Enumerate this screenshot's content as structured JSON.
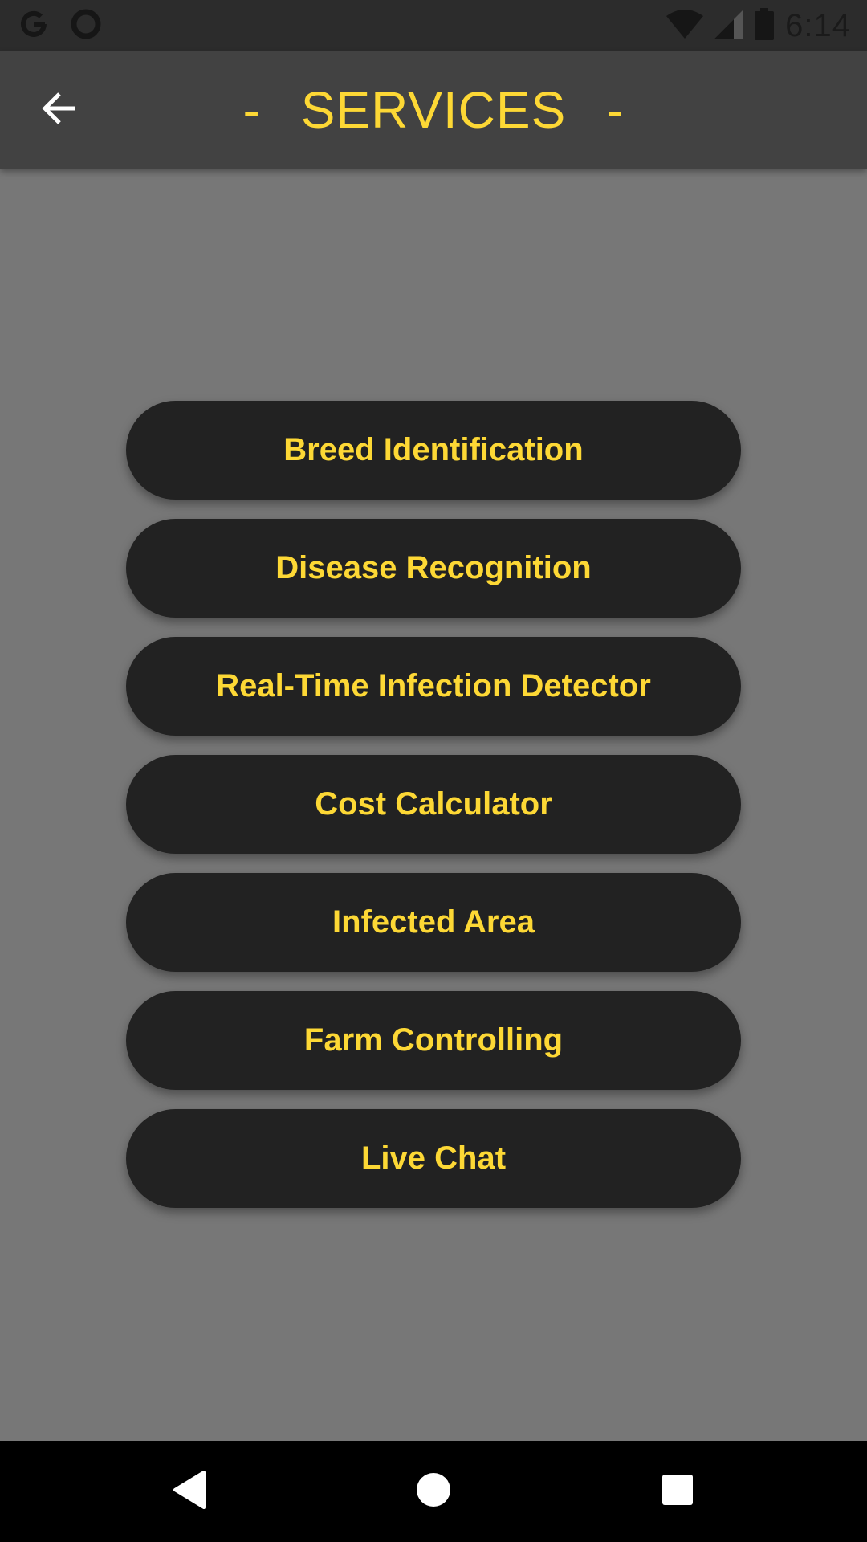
{
  "status_bar": {
    "time": "6:14",
    "icons": [
      "google-icon",
      "circle-notification-icon",
      "wifi-icon",
      "signal-icon",
      "battery-icon"
    ]
  },
  "app_bar": {
    "title": "SERVICES",
    "title_dash_left": "-",
    "title_dash_right": "-",
    "back_icon": "arrow-back-icon"
  },
  "services": [
    {
      "label": "Breed Identification"
    },
    {
      "label": "Disease Recognition"
    },
    {
      "label": "Real-Time Infection Detector"
    },
    {
      "label": "Cost Calculator"
    },
    {
      "label": "Infected Area"
    },
    {
      "label": "Farm Controlling"
    },
    {
      "label": "Live Chat"
    }
  ],
  "nav_bar": {
    "icons": [
      "back-triangle-icon",
      "home-circle-icon",
      "recents-square-icon"
    ]
  },
  "colors": {
    "background": "#777777",
    "app_bar": "#424242",
    "status_bar": "#2c2c2c",
    "accent": "#FDD835",
    "button": "#222222"
  }
}
